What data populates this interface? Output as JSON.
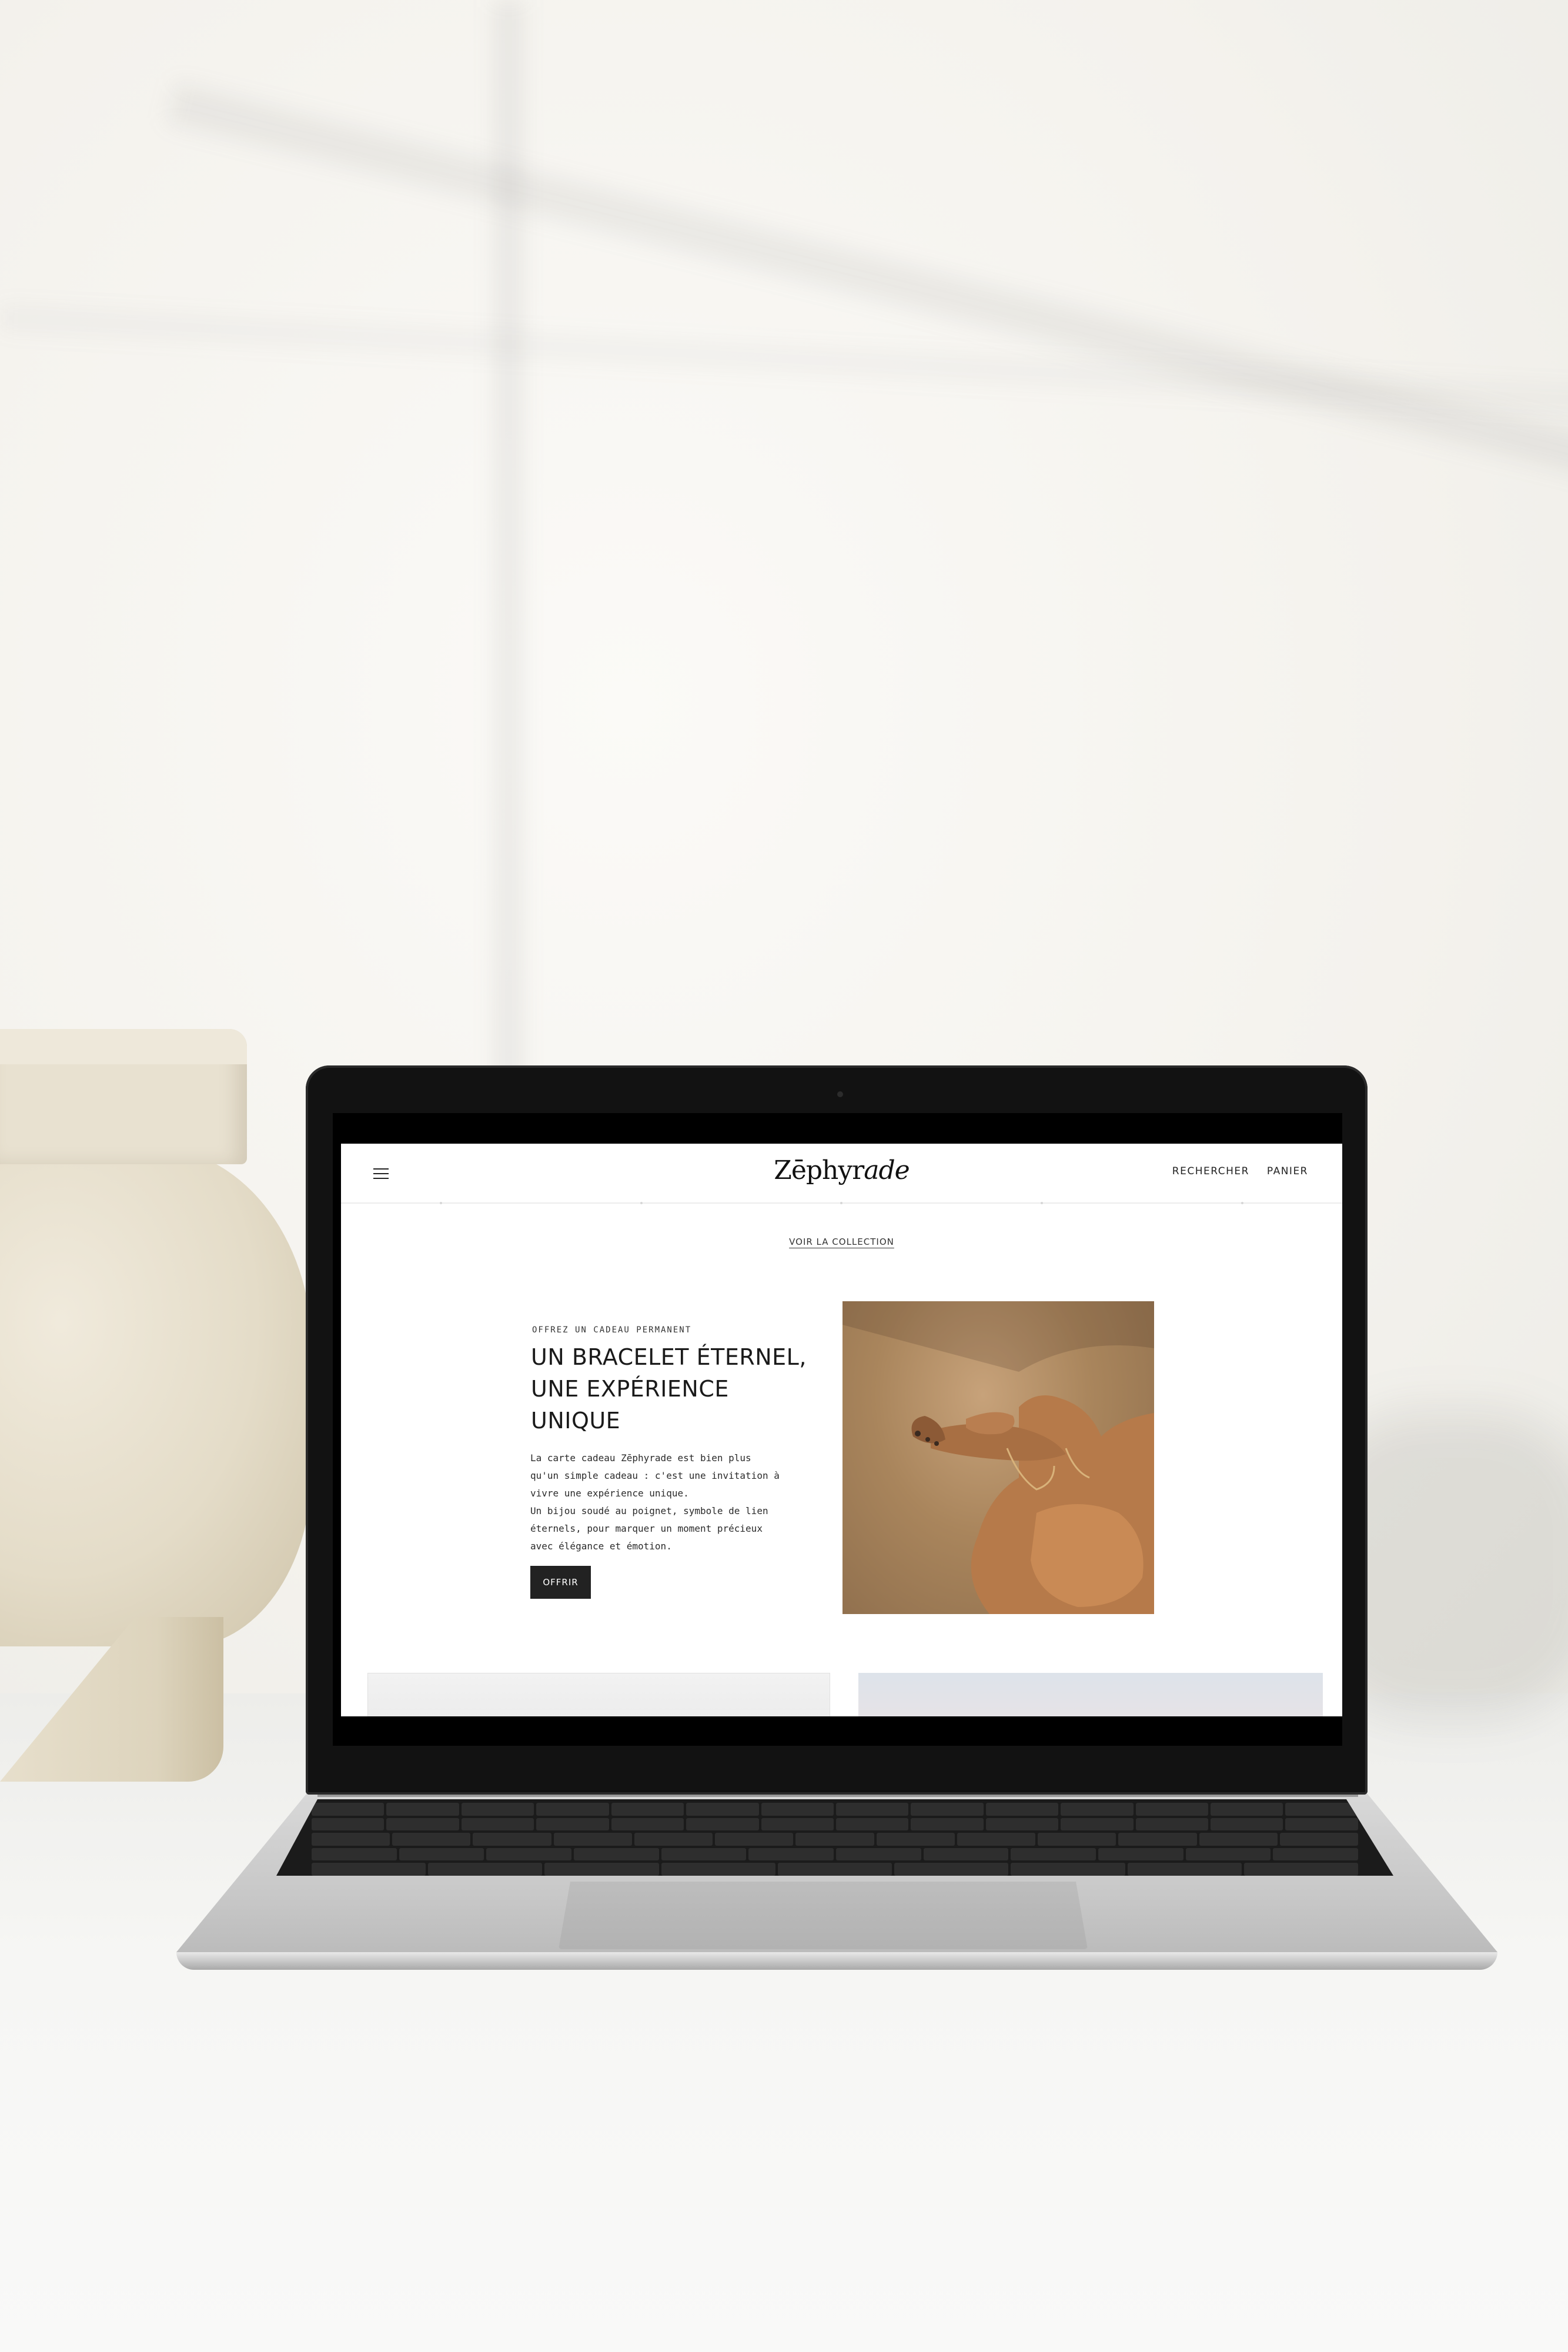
{
  "site": {
    "brand": "Zēphyrade",
    "brand_plain": "Zēphyr",
    "brand_italic": "ade",
    "nav": [
      {
        "label": "RECHERCHER"
      },
      {
        "label": "PANIER"
      }
    ],
    "menu_icon": "hamburger-icon"
  },
  "hero": {
    "collection_link": "VOIR LA COLLECTION",
    "eyebrow": "OFFREZ UN CADEAU PERMANENT",
    "headline": [
      "UN BRACELET ÉTERNEL,",
      "UNE EXPÉRIENCE",
      "UNIQUE"
    ],
    "body": [
      "La carte cadeau Zēphyrade est bien plus",
      "qu'un simple cadeau : c'est une invitation à",
      "vivre une expérience unique.",
      "Un bijou soudé au poignet, symbole de lien",
      "éternels, pour marquer un moment précieux",
      "avec élégance et émotion."
    ],
    "cta_label": "OFFRIR"
  },
  "colors": {
    "accent": "#222222",
    "background": "#ffffff"
  }
}
